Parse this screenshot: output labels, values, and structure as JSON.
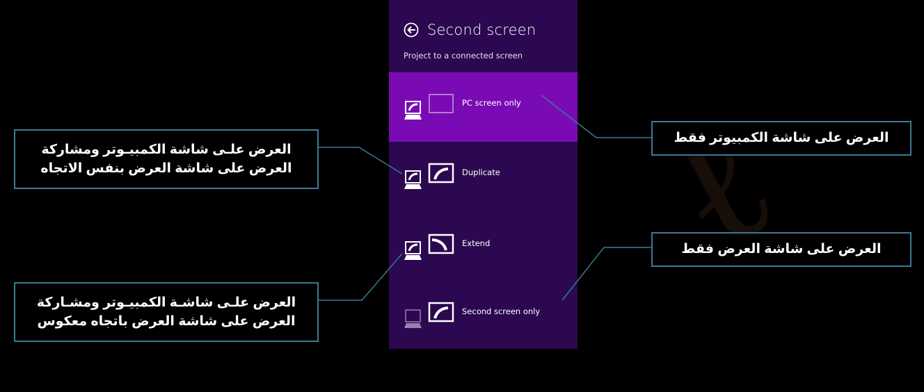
{
  "panel": {
    "title": "Second screen",
    "subtitle": "Project to a connected screen",
    "back_icon": "back-arrow-circle-icon",
    "colors": {
      "background": "#2b0850",
      "selected": "#7a0bb4",
      "text": "#ffffff"
    }
  },
  "options": [
    {
      "label": "PC screen only",
      "selected": true,
      "icon": "pc-screen-only-icon"
    },
    {
      "label": "Duplicate",
      "selected": false,
      "icon": "duplicate-icon"
    },
    {
      "label": "Extend",
      "selected": false,
      "icon": "extend-icon"
    },
    {
      "label": "Second screen only",
      "selected": false,
      "icon": "second-screen-only-icon"
    }
  ],
  "callouts": {
    "pc_only": "العرض على شاشة الكمبيوتر فقط",
    "second_only": "العرض على شاشة العرض فقط",
    "duplicate": [
      "العرض علـى شاشة الكمبيـوتر ومشاركة",
      "العرض على شاشة العرض بنفس الاتجاه"
    ],
    "extend": [
      "العرض علـى شاشـة الكمبيـوتر ومشـاركة",
      "العرض على شاشة العرض باتجاه معكوس"
    ],
    "border_color": "#3a7a94"
  }
}
